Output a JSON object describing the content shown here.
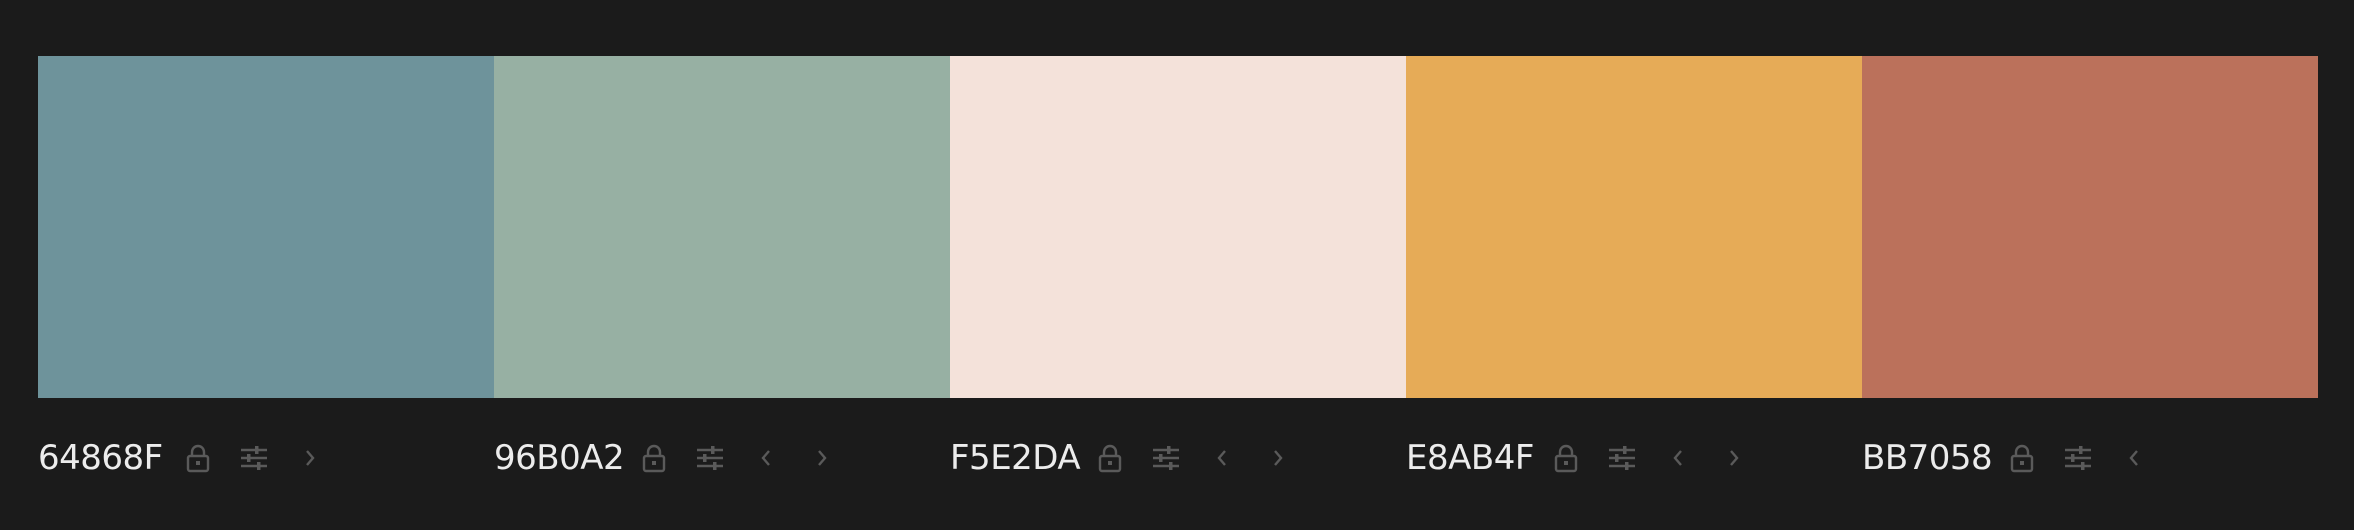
{
  "swatches": [
    {
      "hex": "64868F",
      "color": "#6E939B",
      "has_prev": false,
      "has_next": true
    },
    {
      "hex": "96B0A2",
      "color": "#97B0A3",
      "has_prev": true,
      "has_next": true
    },
    {
      "hex": "F5E2DA",
      "color": "#F4E2DA",
      "has_prev": true,
      "has_next": true
    },
    {
      "hex": "E8AB4F",
      "color": "#E6AB57",
      "has_prev": true,
      "has_next": true
    },
    {
      "hex": "BB7058",
      "color": "#BB715B",
      "has_prev": true,
      "has_next": false
    }
  ],
  "icons": {
    "lock": "lock-icon",
    "adjust": "sliders-icon",
    "prev": "chevron-left-icon",
    "next": "chevron-right-icon"
  },
  "theme": {
    "background": "#1B1B1B",
    "text": "#ECECEC",
    "icon": "#5A5A5A"
  }
}
